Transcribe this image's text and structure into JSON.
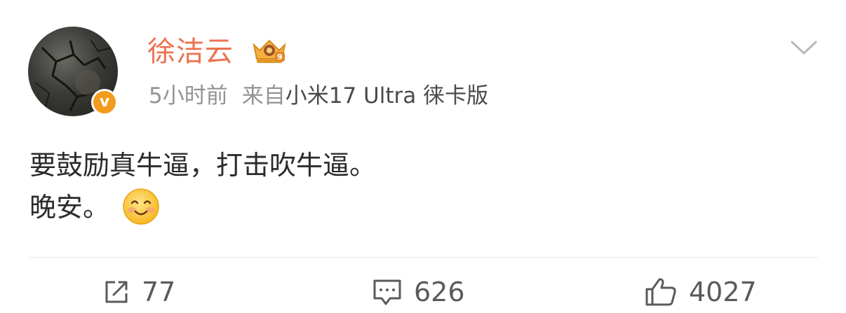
{
  "user": {
    "name": "徐洁云",
    "verified_mark": "v",
    "badge_icon": "crown-badge-icon"
  },
  "meta": {
    "time": "5小时前",
    "source_prefix": "来自",
    "device": "小米17 Ultra 徕卡版"
  },
  "post": {
    "line1": "要鼓励真牛逼，打击吹牛逼。",
    "line2": "晚安。",
    "emoji": "smile-emoji-icon"
  },
  "actions": {
    "reposts": "77",
    "comments": "626",
    "likes": "4027"
  },
  "colors": {
    "username": "#eb7350",
    "meta": "#939393",
    "verified": "#f29b1c",
    "text": "#2b2b2b"
  }
}
